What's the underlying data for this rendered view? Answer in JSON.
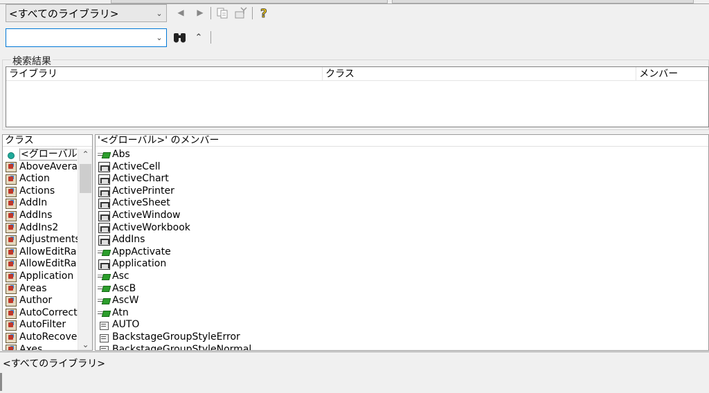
{
  "toolbar": {
    "library_combo": "<すべてのライブラリ>",
    "search_combo": "",
    "icons": [
      "back-icon",
      "forward-icon",
      "copy-icon",
      "view-definition-icon",
      "help-icon",
      "search-binoculars-icon",
      "collapse-icon"
    ]
  },
  "search_results": {
    "title": "検索結果",
    "columns": [
      "ライブラリ",
      "クラス",
      "メンバー"
    ]
  },
  "classes": {
    "header": "クラス",
    "items": [
      {
        "label": "<グローバル>",
        "icon": "globe-icon",
        "selected": true
      },
      {
        "label": "AboveAvera",
        "icon": "class-icon"
      },
      {
        "label": "Action",
        "icon": "class-icon"
      },
      {
        "label": "Actions",
        "icon": "class-icon"
      },
      {
        "label": "AddIn",
        "icon": "class-icon"
      },
      {
        "label": "AddIns",
        "icon": "class-icon"
      },
      {
        "label": "AddIns2",
        "icon": "class-icon"
      },
      {
        "label": "Adjustments",
        "icon": "class-icon"
      },
      {
        "label": "AllowEditRa",
        "icon": "class-icon"
      },
      {
        "label": "AllowEditRa",
        "icon": "class-icon"
      },
      {
        "label": "Application",
        "icon": "class-icon"
      },
      {
        "label": "Areas",
        "icon": "class-icon"
      },
      {
        "label": "Author",
        "icon": "class-icon"
      },
      {
        "label": "AutoCorrect",
        "icon": "class-icon"
      },
      {
        "label": "AutoFilter",
        "icon": "class-icon"
      },
      {
        "label": "AutoRecove",
        "icon": "class-icon"
      },
      {
        "label": "Axes",
        "icon": "class-icon"
      }
    ]
  },
  "members": {
    "header": "'<グローバル>' のメンバー",
    "items": [
      {
        "label": "Abs",
        "icon": "method-icon"
      },
      {
        "label": "ActiveCell",
        "icon": "property-icon"
      },
      {
        "label": "ActiveChart",
        "icon": "property-icon"
      },
      {
        "label": "ActivePrinter",
        "icon": "property-icon"
      },
      {
        "label": "ActiveSheet",
        "icon": "property-icon"
      },
      {
        "label": "ActiveWindow",
        "icon": "property-icon"
      },
      {
        "label": "ActiveWorkbook",
        "icon": "property-icon"
      },
      {
        "label": "AddIns",
        "icon": "property-icon"
      },
      {
        "label": "AppActivate",
        "icon": "method-icon"
      },
      {
        "label": "Application",
        "icon": "property-icon"
      },
      {
        "label": "Asc",
        "icon": "method-icon"
      },
      {
        "label": "AscB",
        "icon": "method-icon"
      },
      {
        "label": "AscW",
        "icon": "method-icon"
      },
      {
        "label": "Atn",
        "icon": "method-icon"
      },
      {
        "label": "AUTO",
        "icon": "constant-icon"
      },
      {
        "label": "BackstageGroupStyleError",
        "icon": "constant-icon"
      },
      {
        "label": "BackstageGroupStyleNormal",
        "icon": "constant-icon"
      }
    ]
  },
  "details": {
    "text": "<すべてのライブラリ>"
  }
}
